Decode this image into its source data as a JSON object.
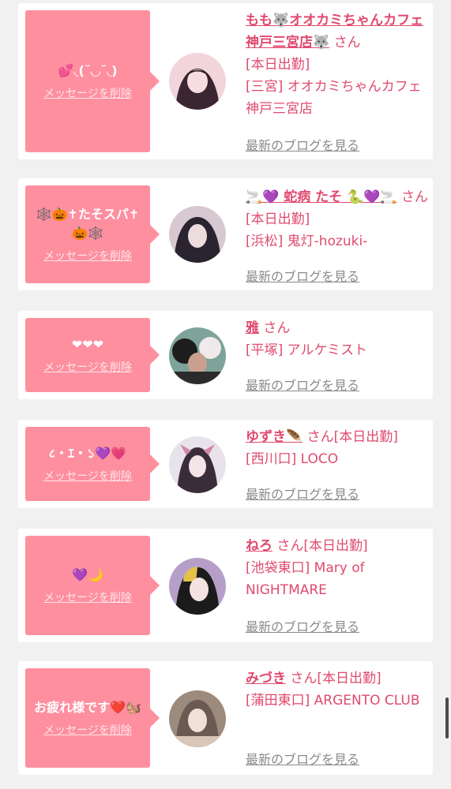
{
  "cards": [
    {
      "message": "💕◟(˘◡˘◟)",
      "delete_label": "メッセージを削除",
      "name": "もも🐺オオカミちゃんカフェ神戸三宮店🐺",
      "san": "さん",
      "status": "[本日出勤]",
      "location": "[三宮] オオカミちゃんカフェ神戸三宮店",
      "blog_label": "最新のブログを見る",
      "avatar_colors": [
        "#3a2630",
        "#c99aa8",
        "#f2d4db"
      ]
    },
    {
      "message": "🕸️🎃✝たそスパ✝🎃🕸️",
      "delete_label": "メッセージを削除",
      "name": "🚬💜 蛇病 たそ 🐍💜🚬",
      "san": "さん",
      "status": "[本日出勤]",
      "location": "[浜松] 鬼灯-hozuki-",
      "blog_label": "最新のブログを見る",
      "avatar_colors": [
        "#2a2430",
        "#8f7f94",
        "#d7c8d2"
      ]
    },
    {
      "message": "❤❤❤",
      "delete_label": "メッセージを削除",
      "name": "雅",
      "san": "さん",
      "status": "",
      "location": "[平塚] アルケミスト",
      "blog_label": "最新のブログを見る",
      "avatar_colors": [
        "#1d1d1d",
        "#c9a090",
        "#7da39a"
      ]
    },
    {
      "message": "८・ｴ・১💜💗",
      "delete_label": "メッセージを削除",
      "name": "ゆずき🪶",
      "san": "さん",
      "status": "[本日出勤]",
      "location": "[西川口] LOCO",
      "blog_label": "最新のブログを見る",
      "avatar_colors": [
        "#e8e2ea",
        "#3a2d3a",
        "#d28aa6"
      ]
    },
    {
      "message": "💜🌙",
      "delete_label": "メッセージを削除",
      "name": "ねろ",
      "san": "さん",
      "status": "[本日出勤]",
      "location": "[池袋東口] Mary of NIGHTMARE",
      "blog_label": "最新のブログを見る",
      "avatar_colors": [
        "#1b1b1b",
        "#e4c24a",
        "#b59fc9"
      ]
    },
    {
      "message": "お疲れ様です❤️🐿️",
      "delete_label": "メッセージを削除",
      "name": "みづき",
      "san": "さん",
      "status": "[本日出勤]",
      "location": "[蒲田東口] ARGENTO CLUB",
      "blog_label": "最新のブログを見る",
      "avatar_colors": [
        "#6b5a52",
        "#d8c6b8",
        "#9c8a7d"
      ]
    }
  ]
}
